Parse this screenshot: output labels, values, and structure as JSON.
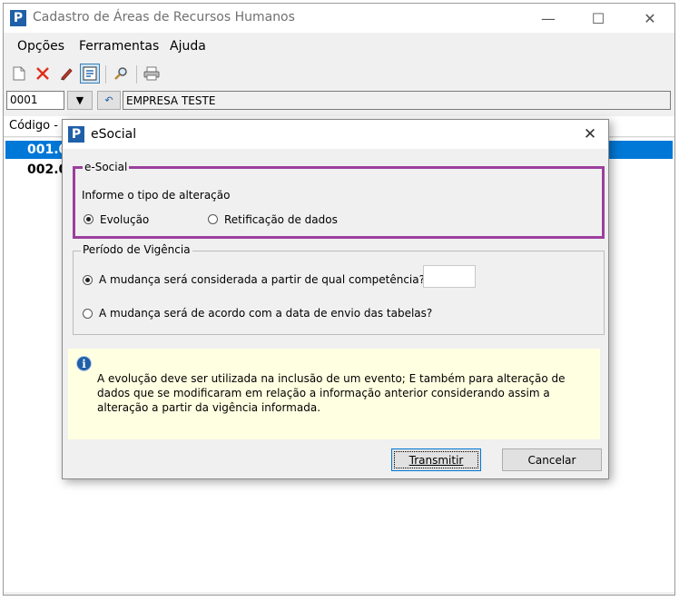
{
  "window": {
    "title": "Cadastro de Áreas de Recursos Humanos",
    "logo_letter": "P",
    "minimize": "—",
    "maximize": "☐",
    "close": "✕"
  },
  "menu": [
    "Opções",
    "Ferramentas",
    "Ajuda"
  ],
  "toolbar": {
    "icons": [
      "new-document-icon",
      "delete-icon",
      "edit-pencil-icon",
      "select-record-icon",
      "search-icon",
      "print-icon"
    ]
  },
  "code_bar": {
    "code": "0001",
    "company": "EMPRESA TESTE"
  },
  "grid": {
    "column_header": "Código -",
    "rows": [
      "001.0",
      "002.0"
    ]
  },
  "dialog": {
    "logo_letter": "P",
    "title": "eSocial",
    "close": "✕",
    "esocial_group": {
      "legend": "e-Social",
      "prompt": "Informe o tipo de alteração",
      "option_evolucao": "Evolução",
      "option_retificacao": "Retificação de dados",
      "selected": "Evolução"
    },
    "vigencia_group": {
      "legend": "Período de Vigência",
      "option_competencia": "A mudança será considerada a partir de qual competência?",
      "option_data_envio": "A mudança será de acordo com a data de envio das tabelas?",
      "competencia_value": "",
      "selected": "competencia"
    },
    "info_icon_letter": "i",
    "info_text": "A evolução deve ser utilizada na inclusão de um evento; E também para alteração de dados que se modificaram em relação a informação anterior considerando assim a alteração a partir da vigência informada.",
    "transmit_label": "Transmitir",
    "cancel_label": "Cancelar"
  }
}
